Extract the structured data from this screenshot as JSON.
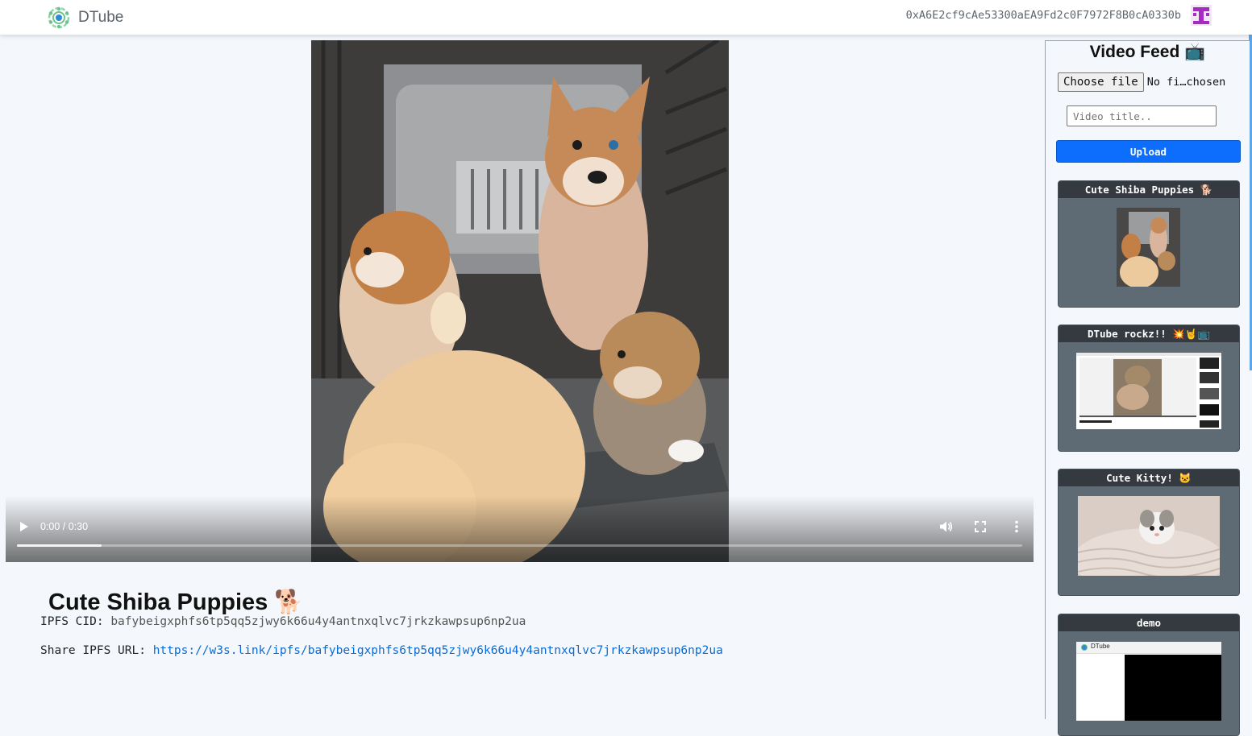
{
  "app": {
    "name": "DTube"
  },
  "account": {
    "address": "0xA6E2cf9cAe53300aEA9Fd2c0F7972F8B0cA0330b"
  },
  "player": {
    "time": "0:00 / 0:30",
    "progress_fraction": 0.084
  },
  "current_video": {
    "title": "Cute Shiba Puppies 🐕",
    "cid_label": "IPFS CID:",
    "cid": "bafybeigxphfs6tp5qq5zjwy6k66u4y4antnxqlvc7jrkzkawpsup6np2ua",
    "share_label": "Share IPFS URL:",
    "share_url": "https://w3s.link/ipfs/bafybeigxphfs6tp5qq5zjwy6k66u4y4antnxqlvc7jrkzkawpsup6np2ua"
  },
  "sidebar": {
    "title": "Video Feed 📺",
    "choose_file_label": "Choose file",
    "file_status": "No fi…chosen",
    "title_placeholder": "Video title..",
    "upload_label": "Upload",
    "videos": [
      {
        "title": "Cute Shiba Puppies 🐕"
      },
      {
        "title": "DTube rockz!! 💥🤘📺"
      },
      {
        "title": "Cute Kitty! 🐱"
      },
      {
        "title": "demo"
      }
    ],
    "demo_thumb_brand": "DTube"
  },
  "colors": {
    "accent": "#0d6efd",
    "link": "#0b6bd6",
    "card_header": "#343a40",
    "card_body": "#5e6a74"
  }
}
